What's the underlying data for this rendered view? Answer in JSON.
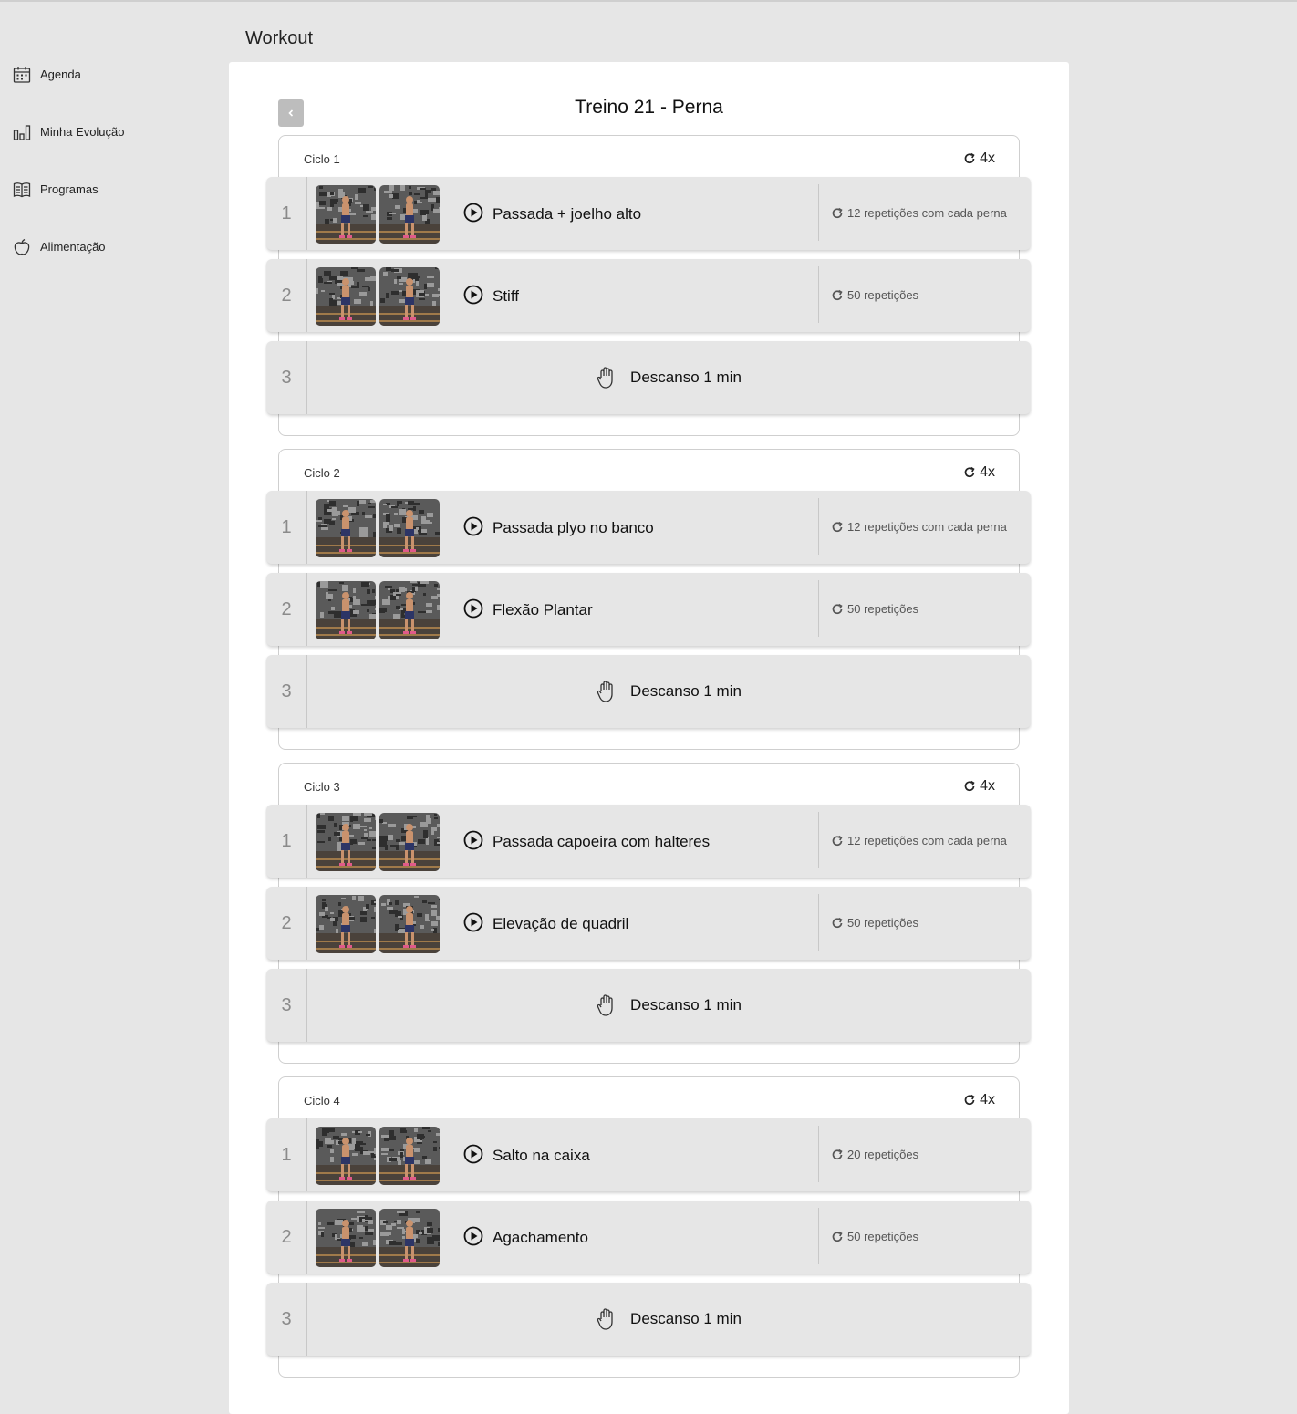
{
  "sidebar": {
    "items": [
      {
        "label": "Agenda",
        "icon": "calendar-icon"
      },
      {
        "label": "Minha Evolução",
        "icon": "bar-chart-icon"
      },
      {
        "label": "Programas",
        "icon": "book-icon"
      },
      {
        "label": "Alimentação",
        "icon": "apple-icon"
      }
    ]
  },
  "header": {
    "title": "Workout"
  },
  "workout": {
    "title": "Treino 21 - Perna",
    "cycles": [
      {
        "label": "Ciclo 1",
        "rounds": "4x",
        "exercises": [
          {
            "num": "1",
            "name": "Passada + joelho alto",
            "reps": "12 repetições com cada perna"
          },
          {
            "num": "2",
            "name": "Stiff",
            "reps": "50 repetições"
          }
        ],
        "rest": {
          "num": "3",
          "label": "Descanso 1 min"
        }
      },
      {
        "label": "Ciclo 2",
        "rounds": "4x",
        "exercises": [
          {
            "num": "1",
            "name": "Passada plyo no banco",
            "reps": "12 repetições com cada perna"
          },
          {
            "num": "2",
            "name": "Flexão Plantar",
            "reps": "50 repetições"
          }
        ],
        "rest": {
          "num": "3",
          "label": "Descanso 1 min"
        }
      },
      {
        "label": "Ciclo 3",
        "rounds": "4x",
        "exercises": [
          {
            "num": "1",
            "name": "Passada capoeira com halteres",
            "reps": "12 repetições com cada perna"
          },
          {
            "num": "2",
            "name": "Elevação de quadril",
            "reps": "50 repetições"
          }
        ],
        "rest": {
          "num": "3",
          "label": "Descanso 1 min"
        }
      },
      {
        "label": "Ciclo 4",
        "rounds": "4x",
        "exercises": [
          {
            "num": "1",
            "name": "Salto na caixa",
            "reps": "20 repetições"
          },
          {
            "num": "2",
            "name": "Agachamento",
            "reps": "50 repetições"
          }
        ],
        "rest": {
          "num": "3",
          "label": "Descanso 1 min"
        }
      }
    ]
  }
}
